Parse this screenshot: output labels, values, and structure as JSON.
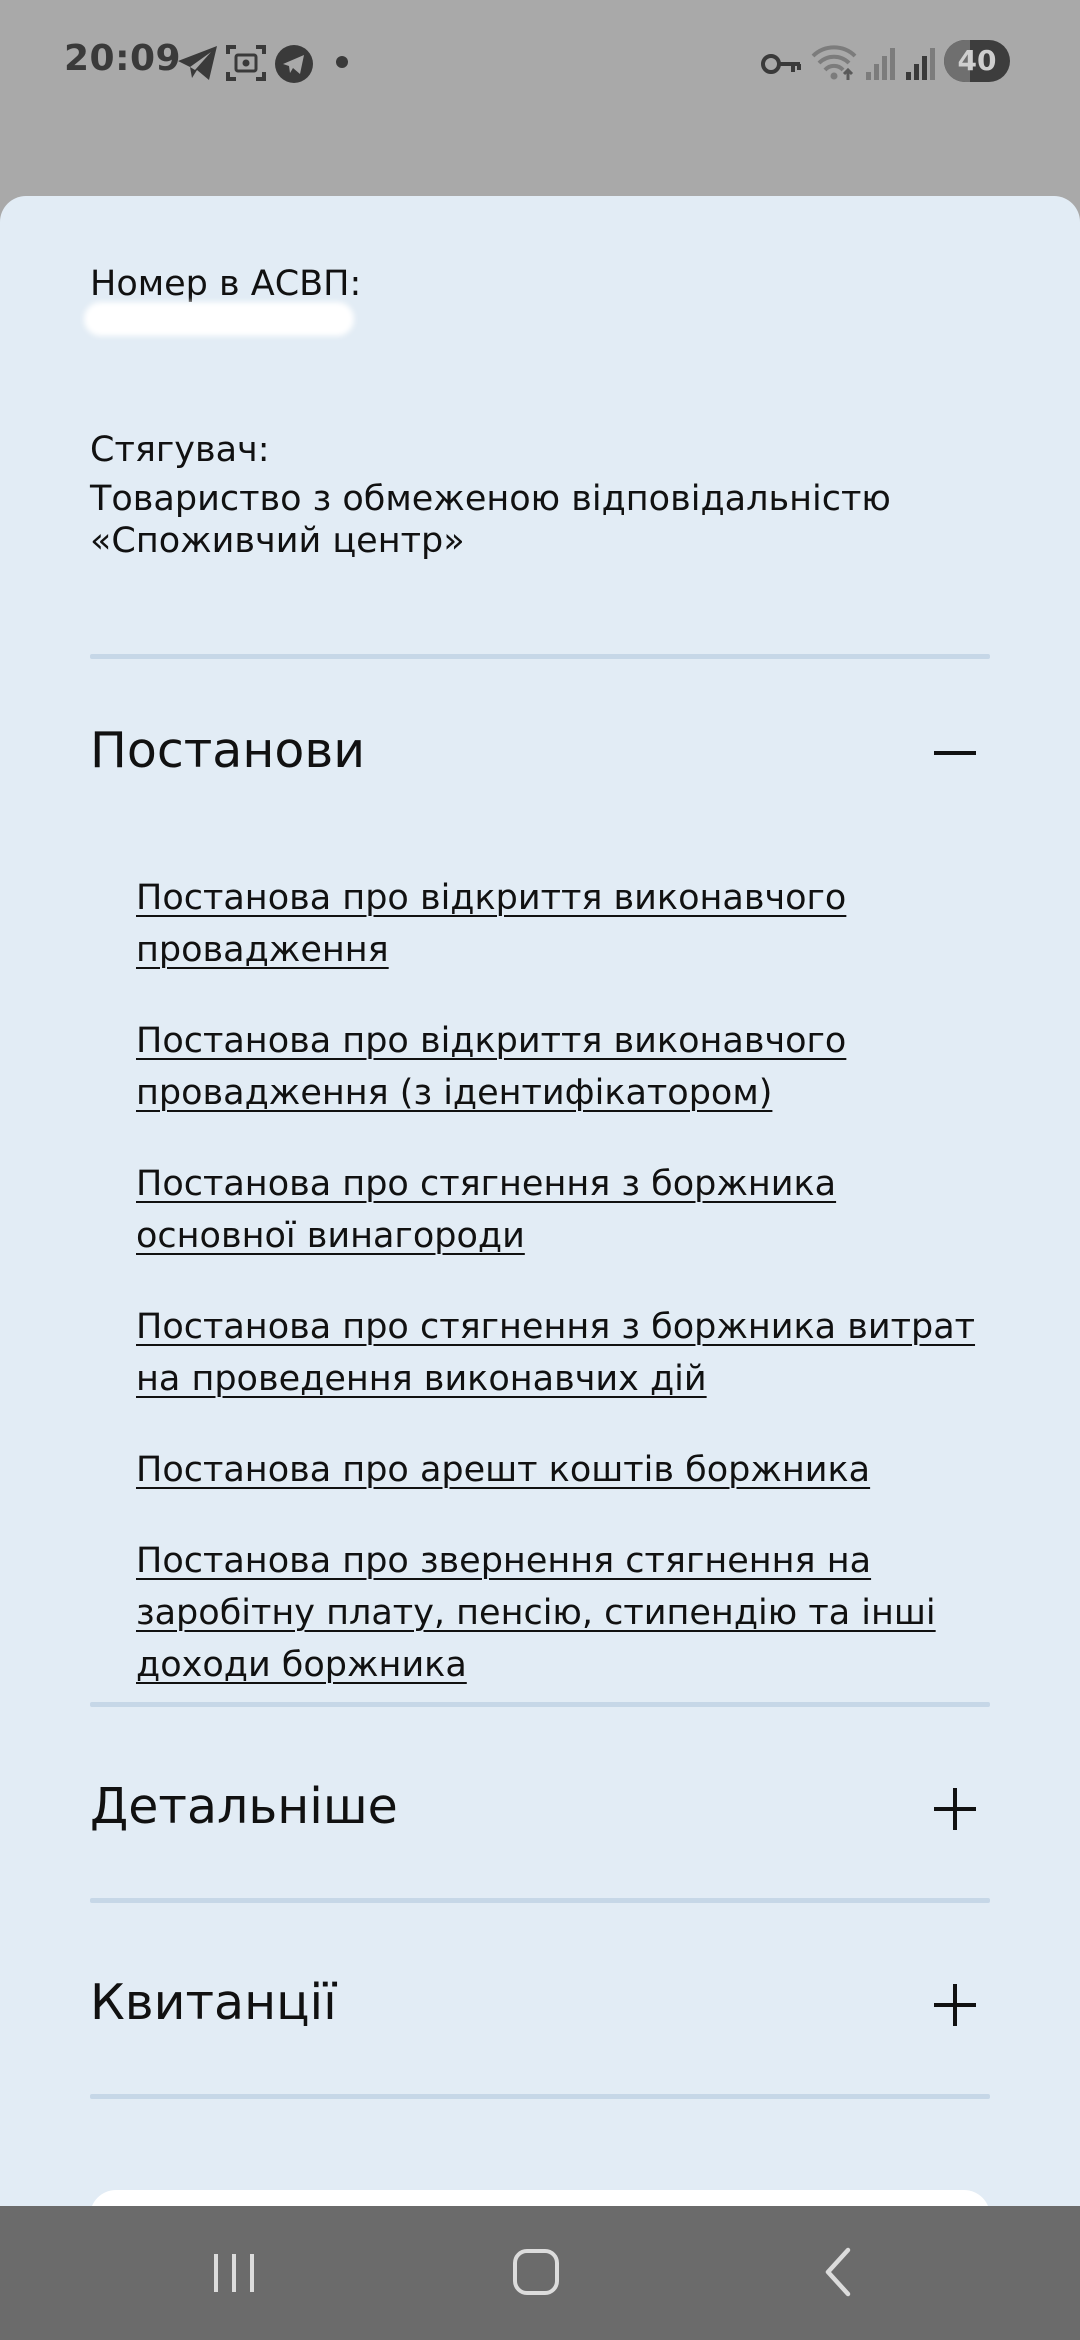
{
  "status_bar": {
    "time": "20:09",
    "battery": "40",
    "icons": [
      "telegram-icon",
      "screenshot-icon",
      "telegram-circle-icon",
      "notification-dot-icon",
      "vpn-key-icon",
      "wifi-icon",
      "signal-icon",
      "signal-icon-2",
      "battery-icon"
    ]
  },
  "details": {
    "asvp_label": "Номер в АСВП:",
    "collector_label": "Стягувач:",
    "collector_value": "Товариство з обмеженою відповідальністю «Споживчий центр»"
  },
  "sections": {
    "resolutions": {
      "title": "Постанови",
      "expanded": true,
      "items": [
        "Постанова про відкриття виконавчого провадження",
        "Постанова про відкриття виконавчого провадження (з ідентифікатором)",
        "Постанова про стягнення з боржника основної винагороди",
        "Постанова про стягнення з боржника витрат на проведення виконавчих дій",
        "Постанова про арешт коштів боржника",
        "Постанова про звернення стягнення на заробітну плату, пенсію, стипендію та інші доходи боржника"
      ]
    },
    "more": {
      "title": "Детальніше",
      "expanded": false
    },
    "receipts": {
      "title": "Квитанції",
      "expanded": false
    }
  },
  "colors": {
    "sheet_bg": "#e2ecf5",
    "divider": "#c6d7e7",
    "nav_bar": "#6b6b6b",
    "status_bar": "#a9a9a9"
  }
}
